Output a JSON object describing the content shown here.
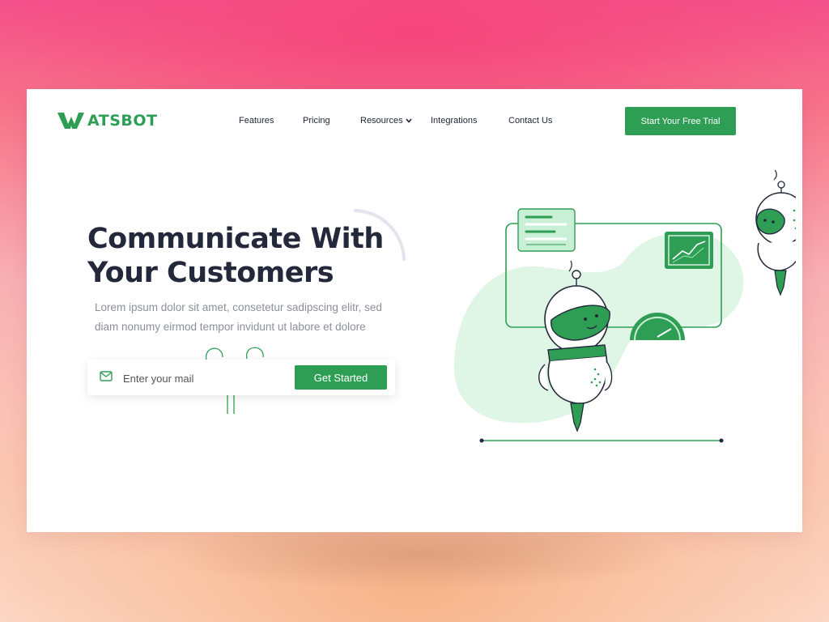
{
  "brand": {
    "logo_mark": "W",
    "logo_text": "ATSBOT",
    "accent_color": "#2f9e55"
  },
  "nav": {
    "items": [
      {
        "label": "Features"
      },
      {
        "label": "Pricing"
      },
      {
        "label": "Resources",
        "icon": "chevron-down-icon"
      },
      {
        "label": "Integrations"
      },
      {
        "label": "Contact Us"
      }
    ],
    "cta_label": "Start Your Free Trial"
  },
  "hero": {
    "title_line1": "Communicate With",
    "title_line2": "Your Customers",
    "subtitle_line1": "Lorem ipsum dolor sit amet, consetetur sadipscing elitr, sed",
    "subtitle_line2": "diam nonumy eirmod tempor invidunt ut labore et dolore",
    "email_placeholder": "Enter your mail",
    "email_icon": "mail-icon",
    "button_label": "Get Started"
  },
  "illustration": {
    "description_icons": [
      "robot-icon",
      "chat-panel-icon",
      "line-chart-icon",
      "gauge-icon"
    ]
  }
}
